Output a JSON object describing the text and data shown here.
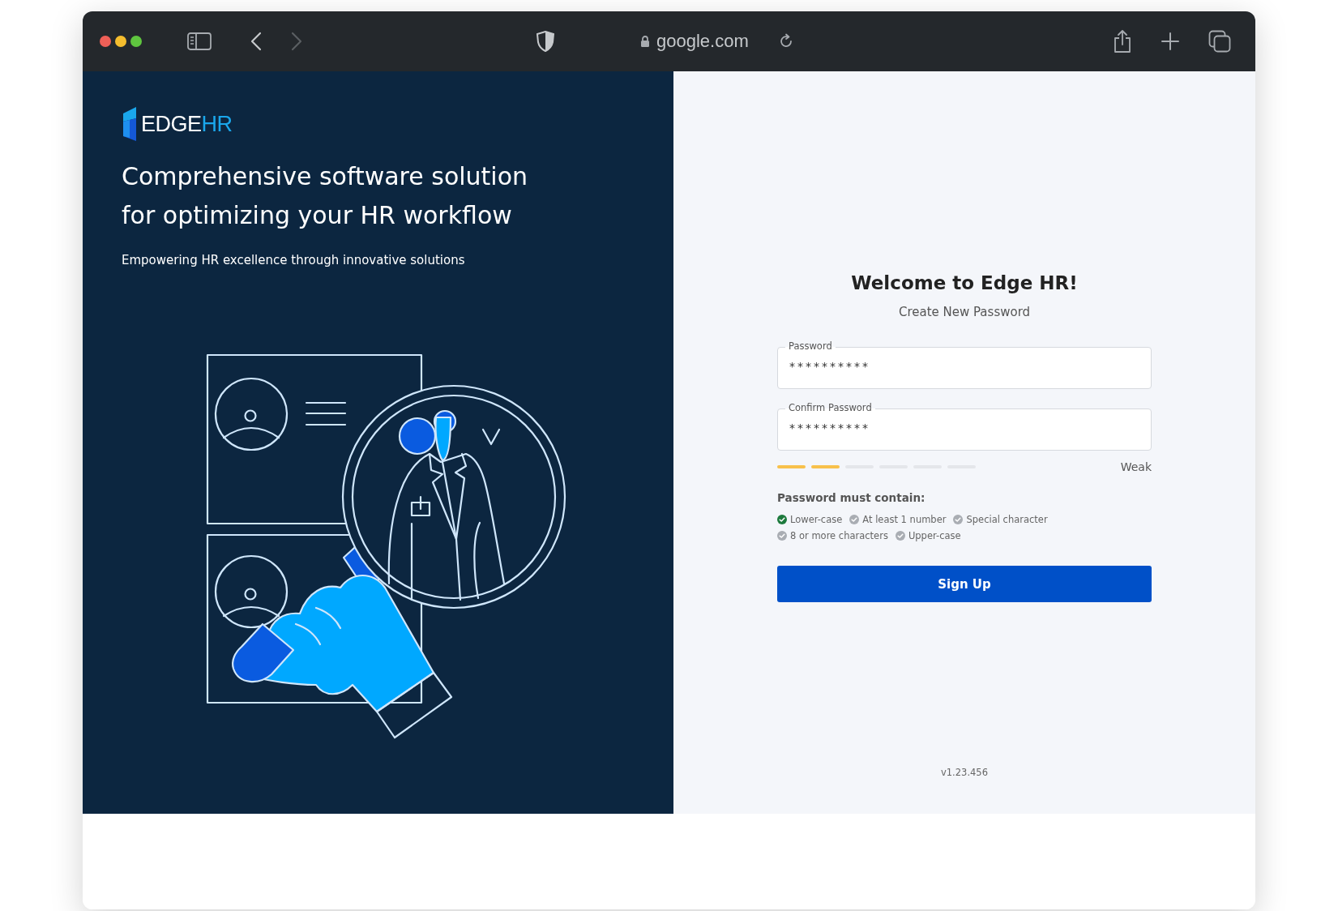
{
  "browser": {
    "url": "google.com",
    "back_disabled": false,
    "forward_disabled": true
  },
  "brand": {
    "logo_primary": "EDGE",
    "logo_accent": "HR",
    "headline": "Comprehensive software solution for optimizing your HR workflow",
    "tagline": "Empowering HR excellence through innovative solutions"
  },
  "form": {
    "title": "Welcome to Edge HR!",
    "subtitle": "Create New Password",
    "fields": [
      {
        "label": "Password",
        "value": "**********"
      },
      {
        "label": "Confirm Password",
        "value": "**********"
      }
    ],
    "strength": {
      "level": 0.3333,
      "label": "Weak"
    },
    "requirements_title": "Password must contain:",
    "requirements": [
      {
        "label": "Lower-case",
        "met": true
      },
      {
        "label": "At  least 1 number",
        "met": false
      },
      {
        "label": "Special character",
        "met": false
      },
      {
        "label": "8 or more characters",
        "met": false
      },
      {
        "label": "Upper-case",
        "met": false
      }
    ],
    "submit": "Sign Up",
    "version": "v1.23.456"
  }
}
